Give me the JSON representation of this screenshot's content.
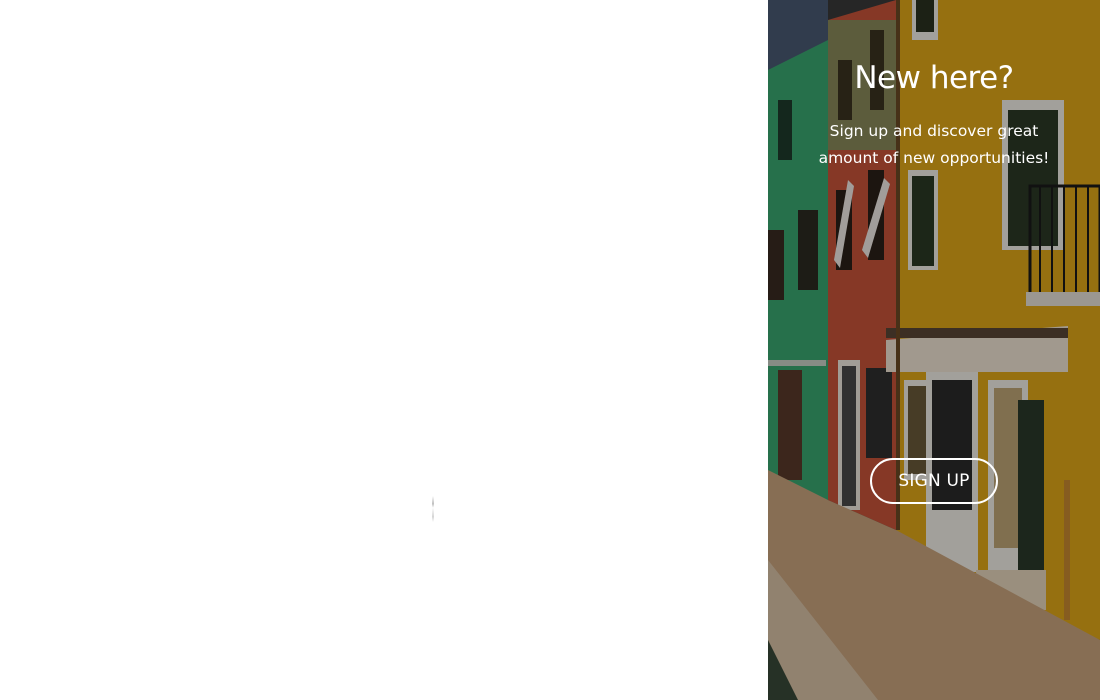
{
  "signup_panel": {
    "title": "New here?",
    "description": "Sign up and discover great amount of new opportunities!",
    "button_label": "SIGN UP"
  }
}
